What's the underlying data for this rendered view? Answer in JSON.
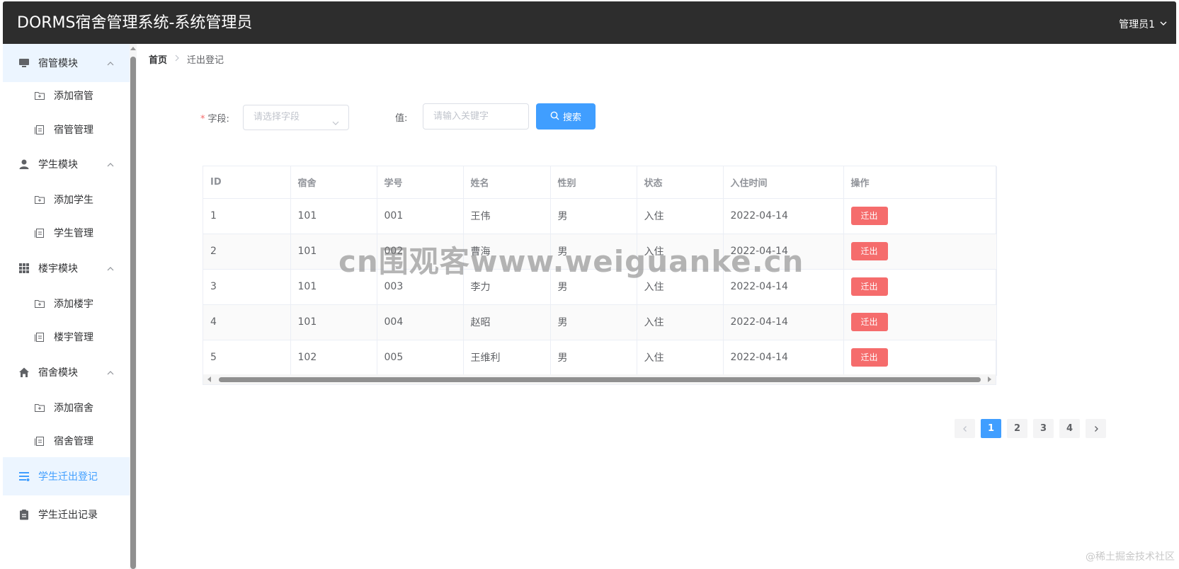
{
  "header": {
    "title": "DORMS宿舍管理系统-系统管理员",
    "user": "管理员1"
  },
  "sidebar": {
    "groups": [
      {
        "label": "宿管模块",
        "icon": "monitor-icon",
        "items": [
          "添加宿管",
          "宿管管理"
        ]
      },
      {
        "label": "学生模块",
        "icon": "user-icon",
        "items": [
          "添加学生",
          "学生管理"
        ]
      },
      {
        "label": "楼宇模块",
        "icon": "grid-icon",
        "items": [
          "添加楼宇",
          "楼宇管理"
        ]
      },
      {
        "label": "宿舍模块",
        "icon": "home-icon",
        "items": [
          "添加宿舍",
          "宿舍管理"
        ]
      }
    ],
    "checkout_register": "学生迁出登记",
    "checkout_records": "学生迁出记录"
  },
  "breadcrumb": {
    "home": "首页",
    "current": "迁出登记"
  },
  "search": {
    "field_label": "字段:",
    "field_placeholder": "请选择字段",
    "value_label": "值:",
    "value_placeholder": "请输入关键字",
    "button": "搜索"
  },
  "table": {
    "columns": [
      "ID",
      "宿舍",
      "学号",
      "姓名",
      "性别",
      "状态",
      "入住时间",
      "操作"
    ],
    "rows": [
      [
        "1",
        "101",
        "001",
        "王伟",
        "男",
        "入住",
        "2022-04-14",
        "迁出"
      ],
      [
        "2",
        "101",
        "002",
        "曹海",
        "男",
        "入住",
        "2022-04-14",
        "迁出"
      ],
      [
        "3",
        "101",
        "003",
        "李力",
        "男",
        "入住",
        "2022-04-14",
        "迁出"
      ],
      [
        "4",
        "101",
        "004",
        "赵昭",
        "男",
        "入住",
        "2022-04-14",
        "迁出"
      ],
      [
        "5",
        "102",
        "005",
        "王维利",
        "男",
        "入住",
        "2022-04-14",
        "迁出"
      ]
    ]
  },
  "pagination": {
    "pages": [
      "1",
      "2",
      "3",
      "4"
    ],
    "current": "1"
  },
  "watermark": "cn围观客www.weiguanke.cn",
  "footer_credit": "@稀土掘金技术社区",
  "colors": {
    "primary": "#409eff",
    "danger": "#f56c6c",
    "header_bg": "#2d2d2d"
  }
}
